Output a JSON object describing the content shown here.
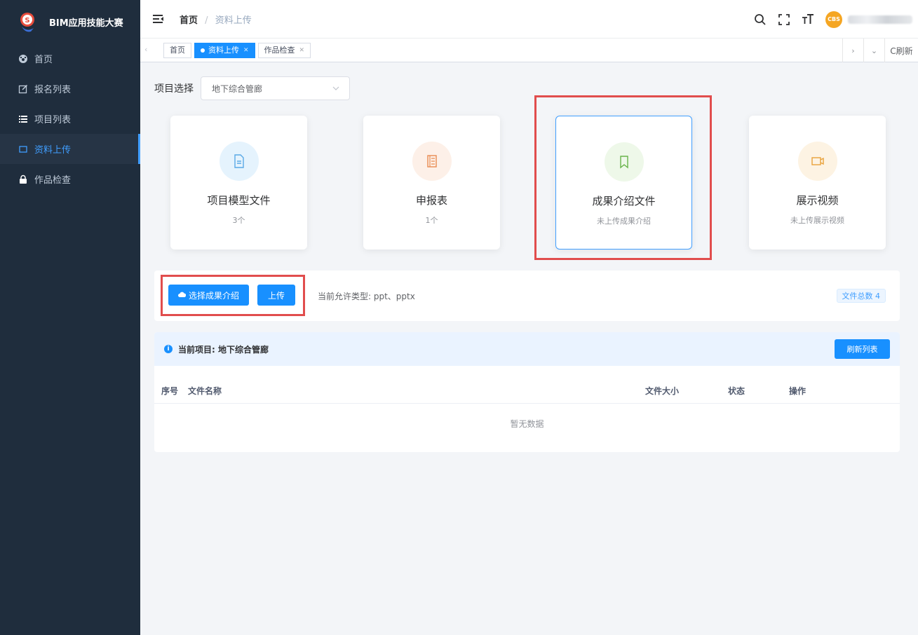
{
  "sidebar": {
    "title": "BIM应用技能大赛",
    "items": [
      {
        "label": "首页",
        "icon": "dashboard-icon"
      },
      {
        "label": "报名列表",
        "icon": "edit-icon"
      },
      {
        "label": "项目列表",
        "icon": "list-icon"
      },
      {
        "label": "资料上传",
        "icon": "upload-box-icon",
        "active": true
      },
      {
        "label": "作品检查",
        "icon": "lock-icon"
      }
    ]
  },
  "navbar": {
    "breadcrumb_home": "首页",
    "breadcrumb_sep": "/",
    "breadcrumb_current": "资料上传",
    "avatar_text": "CBS"
  },
  "tags": {
    "items": [
      "首页",
      "资料上传",
      "作品检查"
    ],
    "refresh": "C刷新"
  },
  "project": {
    "label": "项目选择",
    "selected": "地下综合管廊"
  },
  "cards": [
    {
      "title": "项目模型文件",
      "sub": "3个",
      "icon": "file-icon",
      "color": "#e5f3fd",
      "iconColor": "#5aa9e6"
    },
    {
      "title": "申报表",
      "sub": "1个",
      "icon": "form-icon",
      "color": "#fdf0e8",
      "iconColor": "#e98b52"
    },
    {
      "title": "成果介绍文件",
      "sub": "未上传成果介绍",
      "icon": "bookmark-icon",
      "color": "#eef8e9",
      "iconColor": "#68b34a"
    },
    {
      "title": "展示视频",
      "sub": "未上传展示视频",
      "icon": "video-icon",
      "color": "#fdf3e3",
      "iconColor": "#e9a23b"
    }
  ],
  "upload": {
    "select_label": "选择成果介绍",
    "upload_label": "上传",
    "allow_text": "当前允许类型: ppt、pptx",
    "count_text": "文件总数 4"
  },
  "list": {
    "current_project": "当前项目: 地下综合管廊",
    "refresh_label": "刷新列表",
    "headers": [
      "序号",
      "文件名称",
      "文件大小",
      "状态",
      "操作"
    ],
    "empty_text": "暂无数据"
  },
  "colors": {
    "primary": "#1890ff",
    "sidebar": "#1f2d3d",
    "highlight": "#e14d4d"
  }
}
